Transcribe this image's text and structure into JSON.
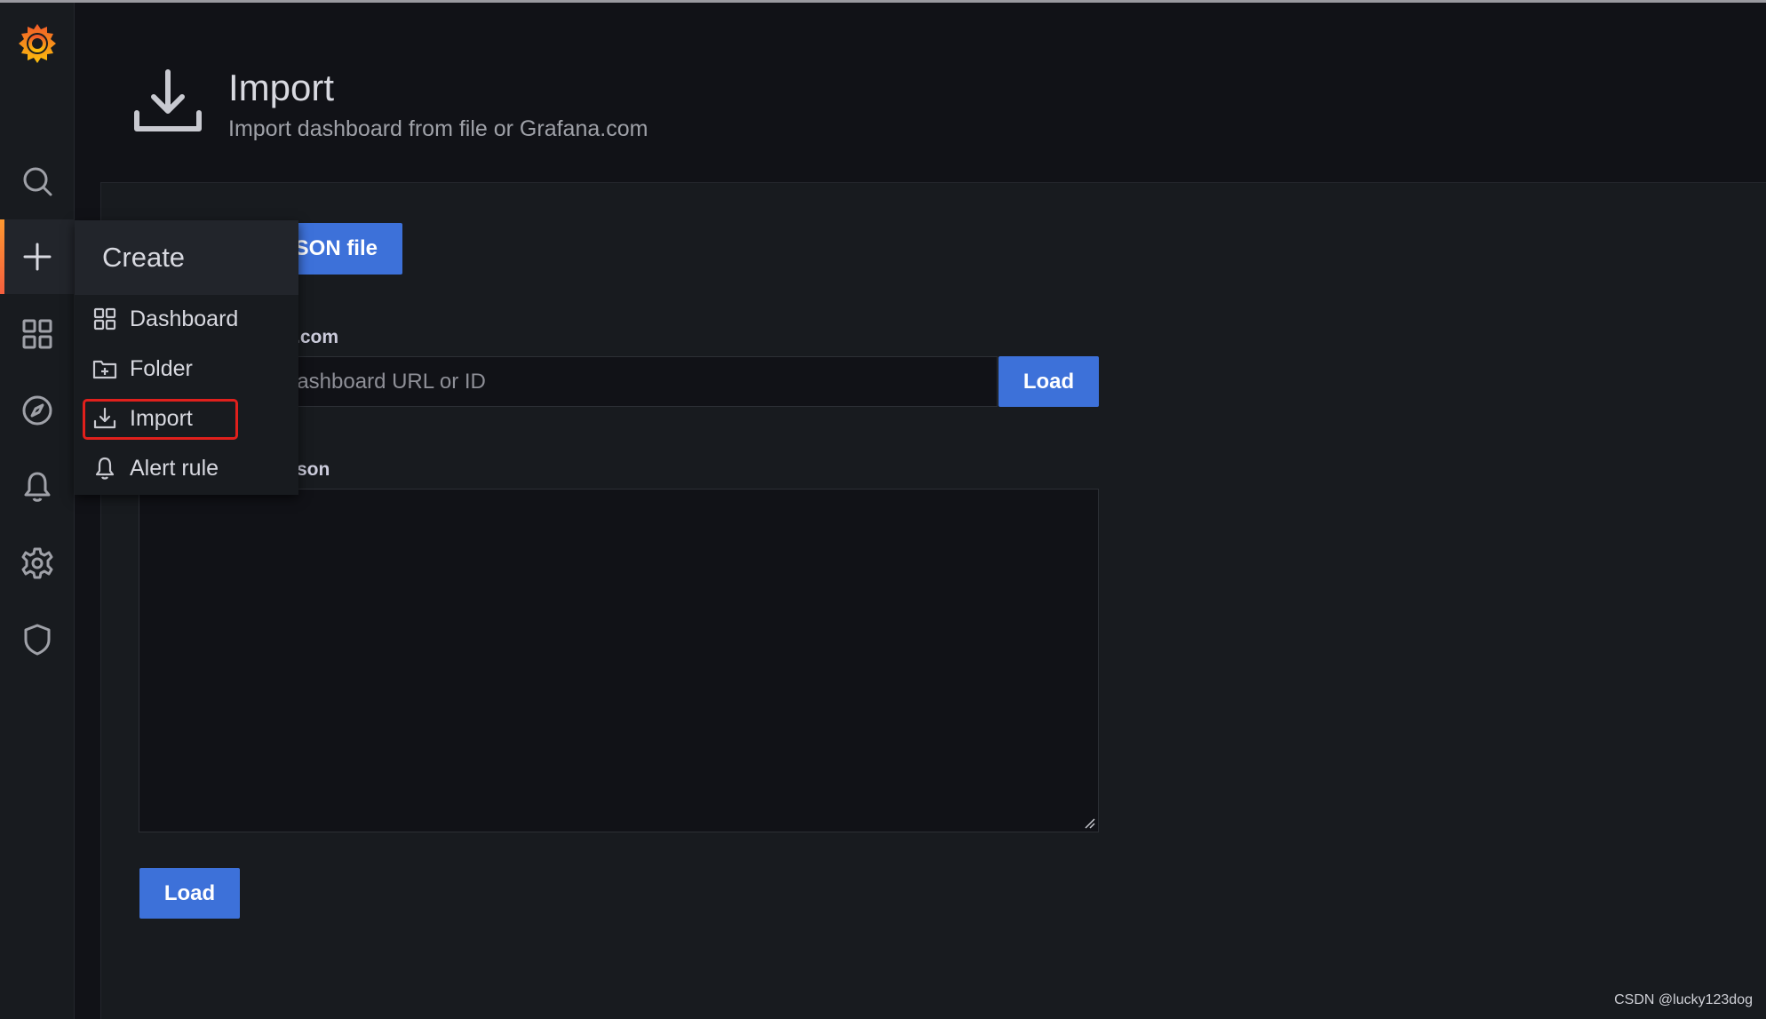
{
  "header": {
    "title": "Import",
    "subtitle": "Import dashboard from file or Grafana.com"
  },
  "form": {
    "upload_button_label": "SON file",
    "grafana_com_label": ".com",
    "url_placeholder_visible": "lashboard URL or ID",
    "url_load_label": "Load",
    "json_label": "son",
    "bottom_load_label": "Load"
  },
  "create_menu": {
    "title": "Create",
    "items": [
      {
        "label": "Dashboard",
        "icon": "apps-icon"
      },
      {
        "label": "Folder",
        "icon": "folder-plus-icon"
      },
      {
        "label": "Import",
        "icon": "import-icon"
      },
      {
        "label": "Alert rule",
        "icon": "bell-icon"
      }
    ]
  },
  "sidebar": {
    "items": [
      {
        "icon": "grafana-logo"
      },
      {
        "icon": "search-icon"
      },
      {
        "icon": "plus-icon",
        "active": true
      },
      {
        "icon": "apps-icon"
      },
      {
        "icon": "compass-icon"
      },
      {
        "icon": "bell-icon"
      },
      {
        "icon": "gear-icon"
      },
      {
        "icon": "shield-icon"
      }
    ]
  },
  "colors": {
    "background": "#111217",
    "panel": "#181b1f",
    "primary": "#3d71d9",
    "accent": "#f55f3e",
    "highlight": "#e0201c"
  },
  "watermark": "CSDN @lucky123dog"
}
